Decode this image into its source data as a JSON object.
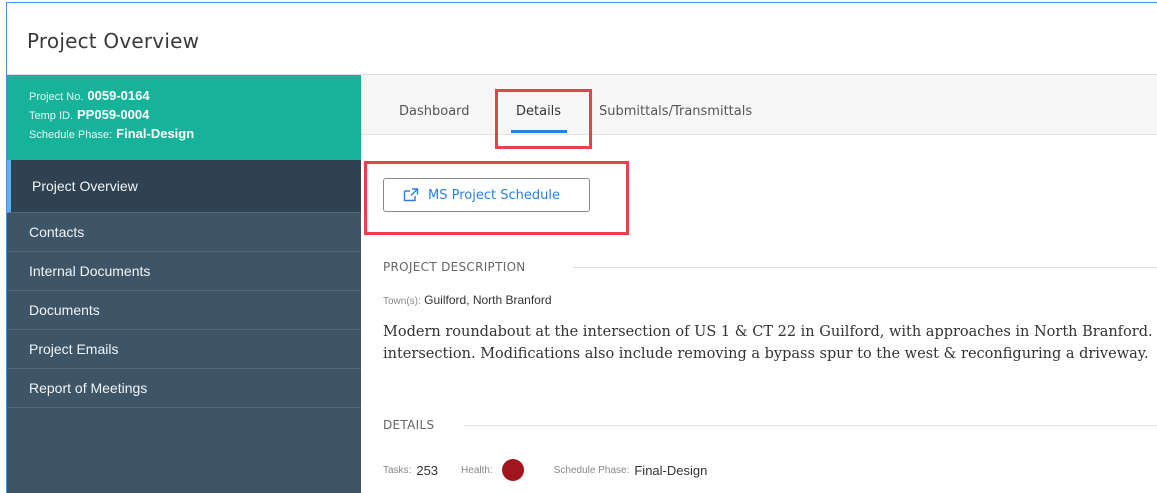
{
  "page": {
    "title": "Project Overview"
  },
  "project_info": {
    "project_no_label": "Project No.",
    "project_no": "0059-0164",
    "temp_id_label": "Temp ID.",
    "temp_id": "PP059-0004",
    "schedule_phase_label": "Schedule Phase:",
    "schedule_phase": "Final-Design"
  },
  "sidebar": {
    "items": [
      {
        "label": "Project Overview",
        "active": true
      },
      {
        "label": "Contacts"
      },
      {
        "label": "Internal Documents"
      },
      {
        "label": "Documents"
      },
      {
        "label": "Project Emails"
      },
      {
        "label": "Report of Meetings"
      }
    ]
  },
  "tabs": [
    {
      "label": "Dashboard"
    },
    {
      "label": "Details",
      "active": true
    },
    {
      "label": "Submittals/Transmittals"
    }
  ],
  "ms_project_button": {
    "label": "MS Project Schedule",
    "icon": "external-link-icon"
  },
  "project_description": {
    "heading": "PROJECT DESCRIPTION",
    "towns_label": "Town(s):",
    "towns": "Guilford, North Branford",
    "line1": "Modern roundabout at the intersection of US 1 & CT 22 in Guilford, with approaches in North Branford.",
    "line2": "intersection. Modifications also include removing a bypass spur to the west & reconfiguring a driveway."
  },
  "details": {
    "heading": "DETAILS",
    "tasks_label": "Tasks:",
    "tasks": "253",
    "health_label": "Health:",
    "health_color": "#a3151d",
    "schedule_phase_label": "Schedule Phase:",
    "schedule_phase": "Final-Design"
  },
  "colors": {
    "accent": "#2b7fd9",
    "header_green": "#16b39a",
    "sidebar": "#3e5467",
    "highlight_red": "#e8414b"
  }
}
